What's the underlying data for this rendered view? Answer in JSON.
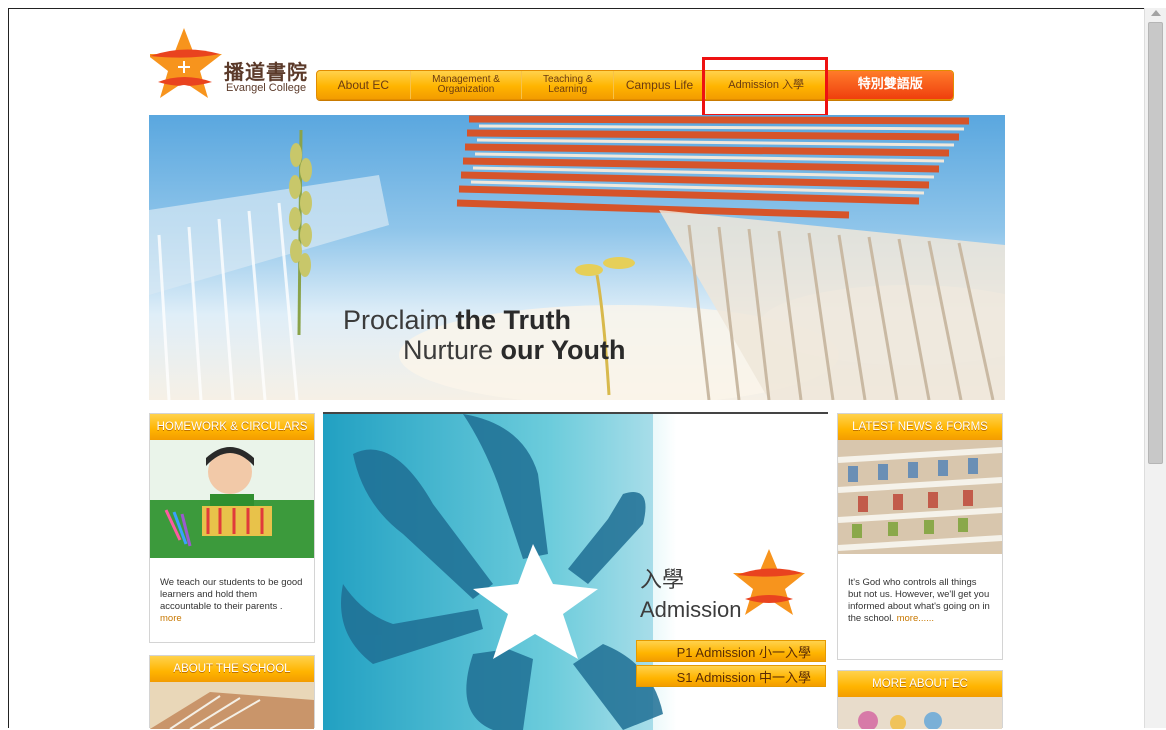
{
  "header": {
    "logo_cn": "播道書院",
    "logo_en": "Evangel College"
  },
  "nav": {
    "items": [
      {
        "label": "About EC"
      },
      {
        "label": "Management & Organization"
      },
      {
        "label": "Teaching & Learning"
      },
      {
        "label": "Campus Life"
      },
      {
        "label": "Admission 入學"
      },
      {
        "label": "特別雙語版"
      }
    ]
  },
  "hero": {
    "line1_light": "Proclaim",
    "line1_bold": "the Truth",
    "line2_light": "Nurture",
    "line2_bold": "our Youth"
  },
  "left": {
    "homework": {
      "title": "HOMEWORK & CIRCULARS",
      "text": "We teach our students to be good learners and hold them accountable to their parents .",
      "more": "more"
    },
    "about": {
      "title": "ABOUT THE SCHOOL"
    }
  },
  "center": {
    "admission_cn": "入學",
    "admission_en": "Admission",
    "p1": "P1 Admission 小一入學",
    "s1": "S1 Admission 中一入學"
  },
  "right": {
    "news": {
      "title": "LATEST NEWS & FORMS",
      "text": "It's God who controls all things but not us. However, we'll get you informed about what's going on in the school.",
      "more": "more......"
    },
    "more_about": {
      "title": "MORE ABOUT EC"
    }
  },
  "colors": {
    "accent_orange": "#ffb400",
    "highlight_red": "#ee1111",
    "special_red": "#ef3f0d"
  }
}
